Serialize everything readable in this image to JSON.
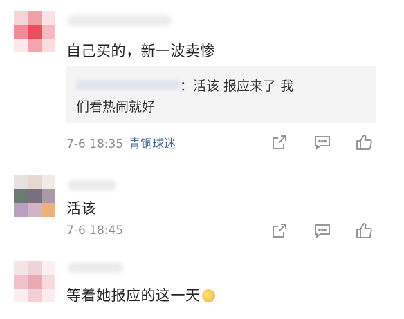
{
  "comments": [
    {
      "text": "自己买的，新一波卖惨",
      "quote": {
        "text": "：活该 报应来了 我们看热闹就好"
      },
      "time": "7-6 18:35",
      "user": "青铜球迷"
    },
    {
      "text": "活该",
      "time": "7-6 18:45"
    },
    {
      "text": "等着她报应的这一天"
    }
  ],
  "icons": [
    "share-icon",
    "comment-icon",
    "like-icon"
  ],
  "colors": {
    "meta_text": "#8a8a8a",
    "username_link": "#3a5d8f",
    "quote_bg": "#f4f4f4"
  }
}
